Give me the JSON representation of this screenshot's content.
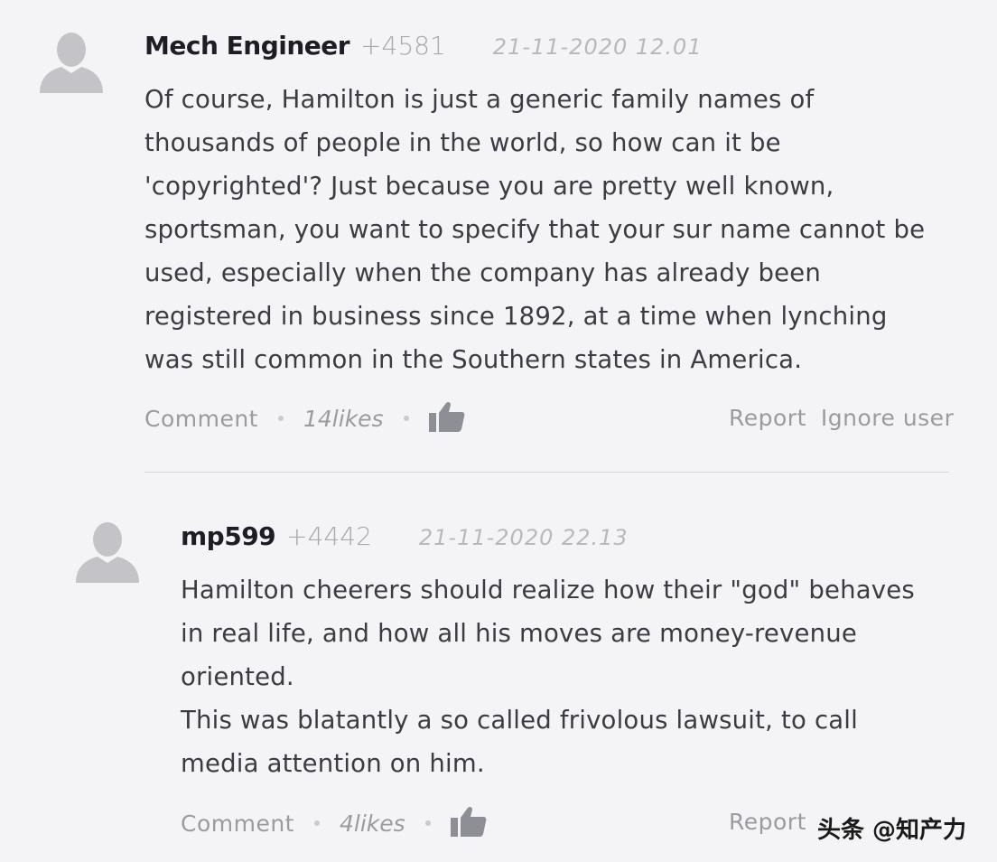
{
  "comments": [
    {
      "author": "Mech Engineer",
      "score": "+4581",
      "date": "21-11-2020 12.01",
      "body": "Of course, Hamilton is just a generic family names of\nthousands of people in the world, so how can it be\n'copyrighted'? Just because you are pretty well known,\nsportsman, you want to specify that your sur name cannot be\nused, especially when the company has already been\nregistered in business since 1892, at a time when lynching\nwas still common in the Southern states in America.",
      "comment_label": "Comment",
      "likes": "14likes",
      "report_label": "Report",
      "ignore_label": "Ignore user"
    },
    {
      "author": "mp599",
      "score": "+4442",
      "date": "21-11-2020 22.13",
      "body": "Hamilton cheerers should realize how their \"god\" behaves\nin real life, and how all his moves are money-revenue\noriented.\nThis was blatantly a so called frivolous lawsuit, to call\nmedia attention on him.",
      "comment_label": "Comment",
      "likes": "4likes",
      "report_label": "Report"
    }
  ],
  "watermark": "头条 @知产力",
  "colors": {
    "background": "#f4f4f6",
    "author": "#1d1d26",
    "muted": "#9a9aa2",
    "thumb": "#8e8e96"
  }
}
